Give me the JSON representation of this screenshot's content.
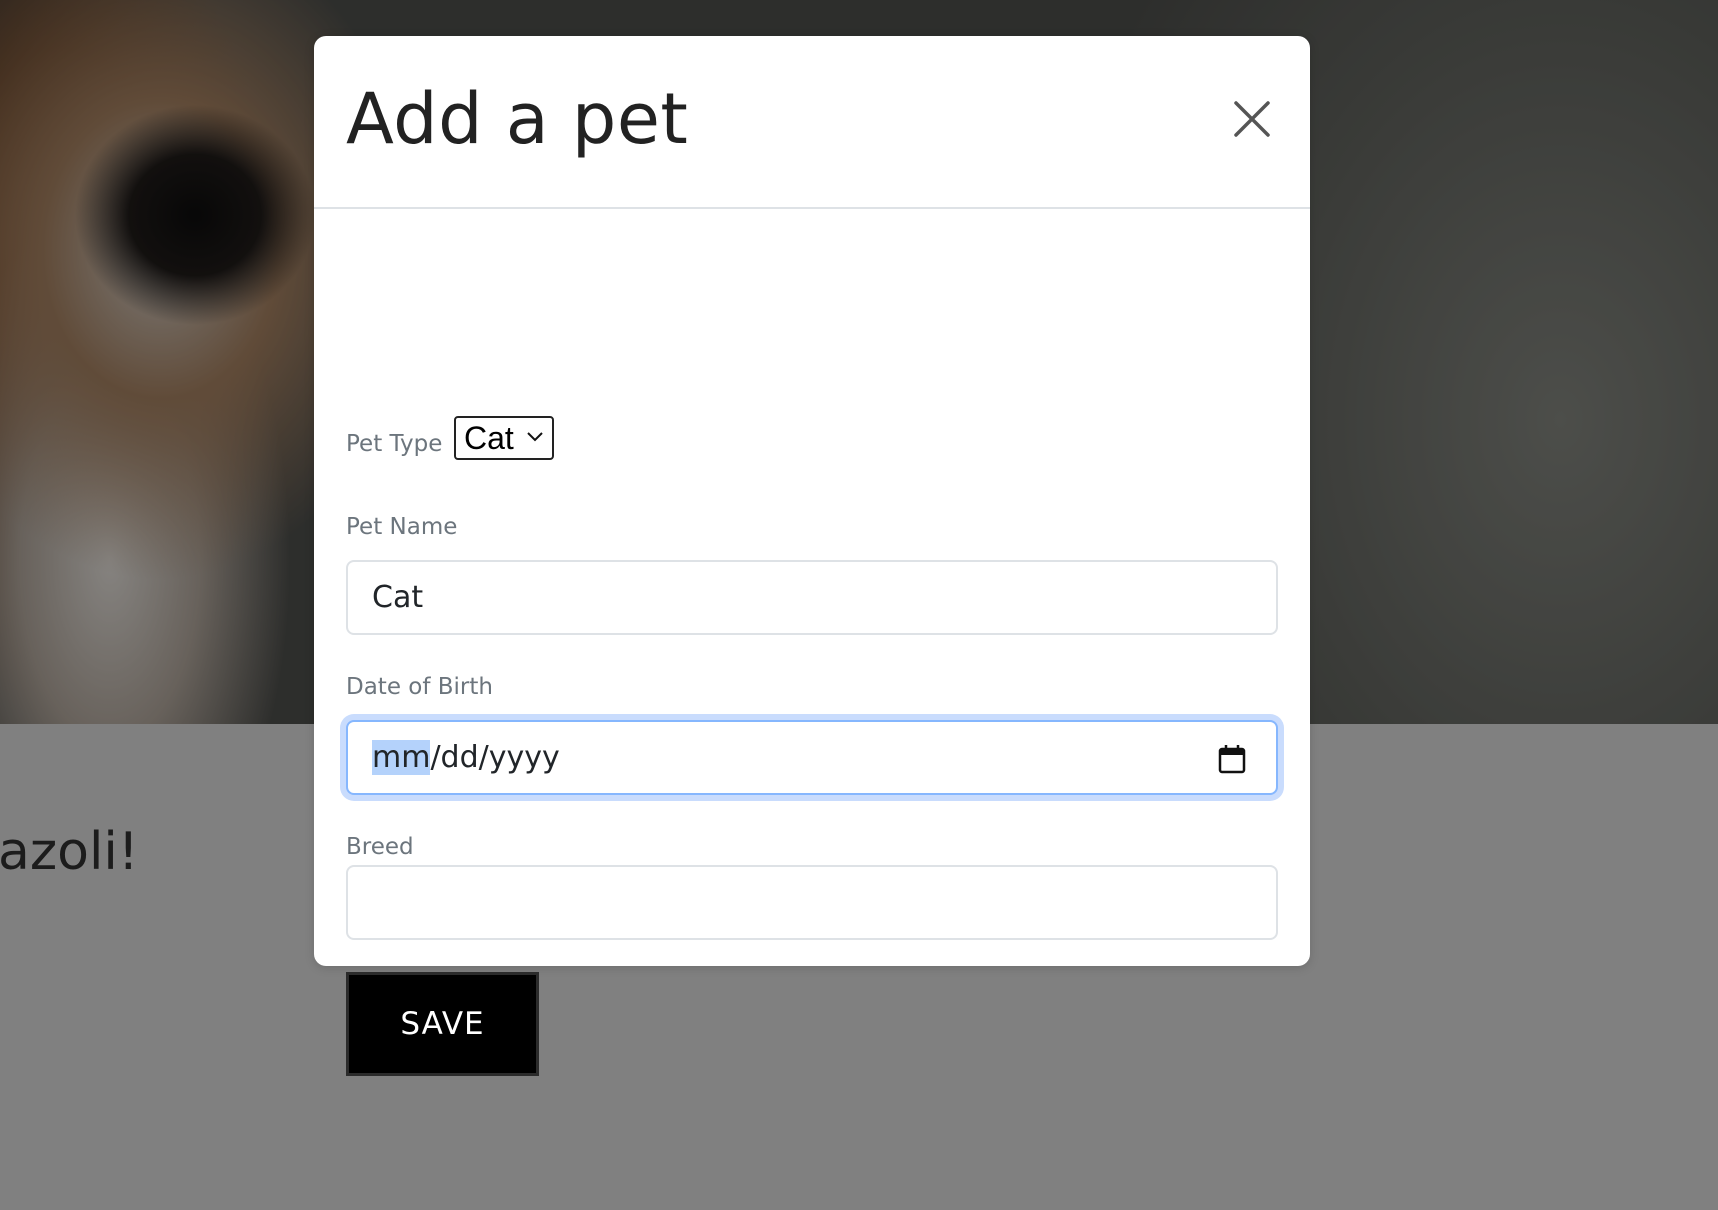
{
  "background": {
    "greeting_text": "azoli!"
  },
  "modal": {
    "title": "Add a pet",
    "close_icon": "close-icon",
    "pet_type": {
      "label": "Pet Type",
      "selected": "Cat",
      "icon": "chevron-down-icon"
    },
    "pet_name": {
      "label": "Pet Name",
      "value": "Cat"
    },
    "date_of_birth": {
      "label": "Date of Birth",
      "placeholder_selected": "mm",
      "placeholder_rest": "/dd/yyyy",
      "icon": "calendar-icon"
    },
    "breed": {
      "label": "Breed",
      "value": ""
    },
    "save_label": "SAVE"
  },
  "colors": {
    "overlay": "#808080",
    "focus_ring": "#86b7fe",
    "button": "#000000"
  }
}
